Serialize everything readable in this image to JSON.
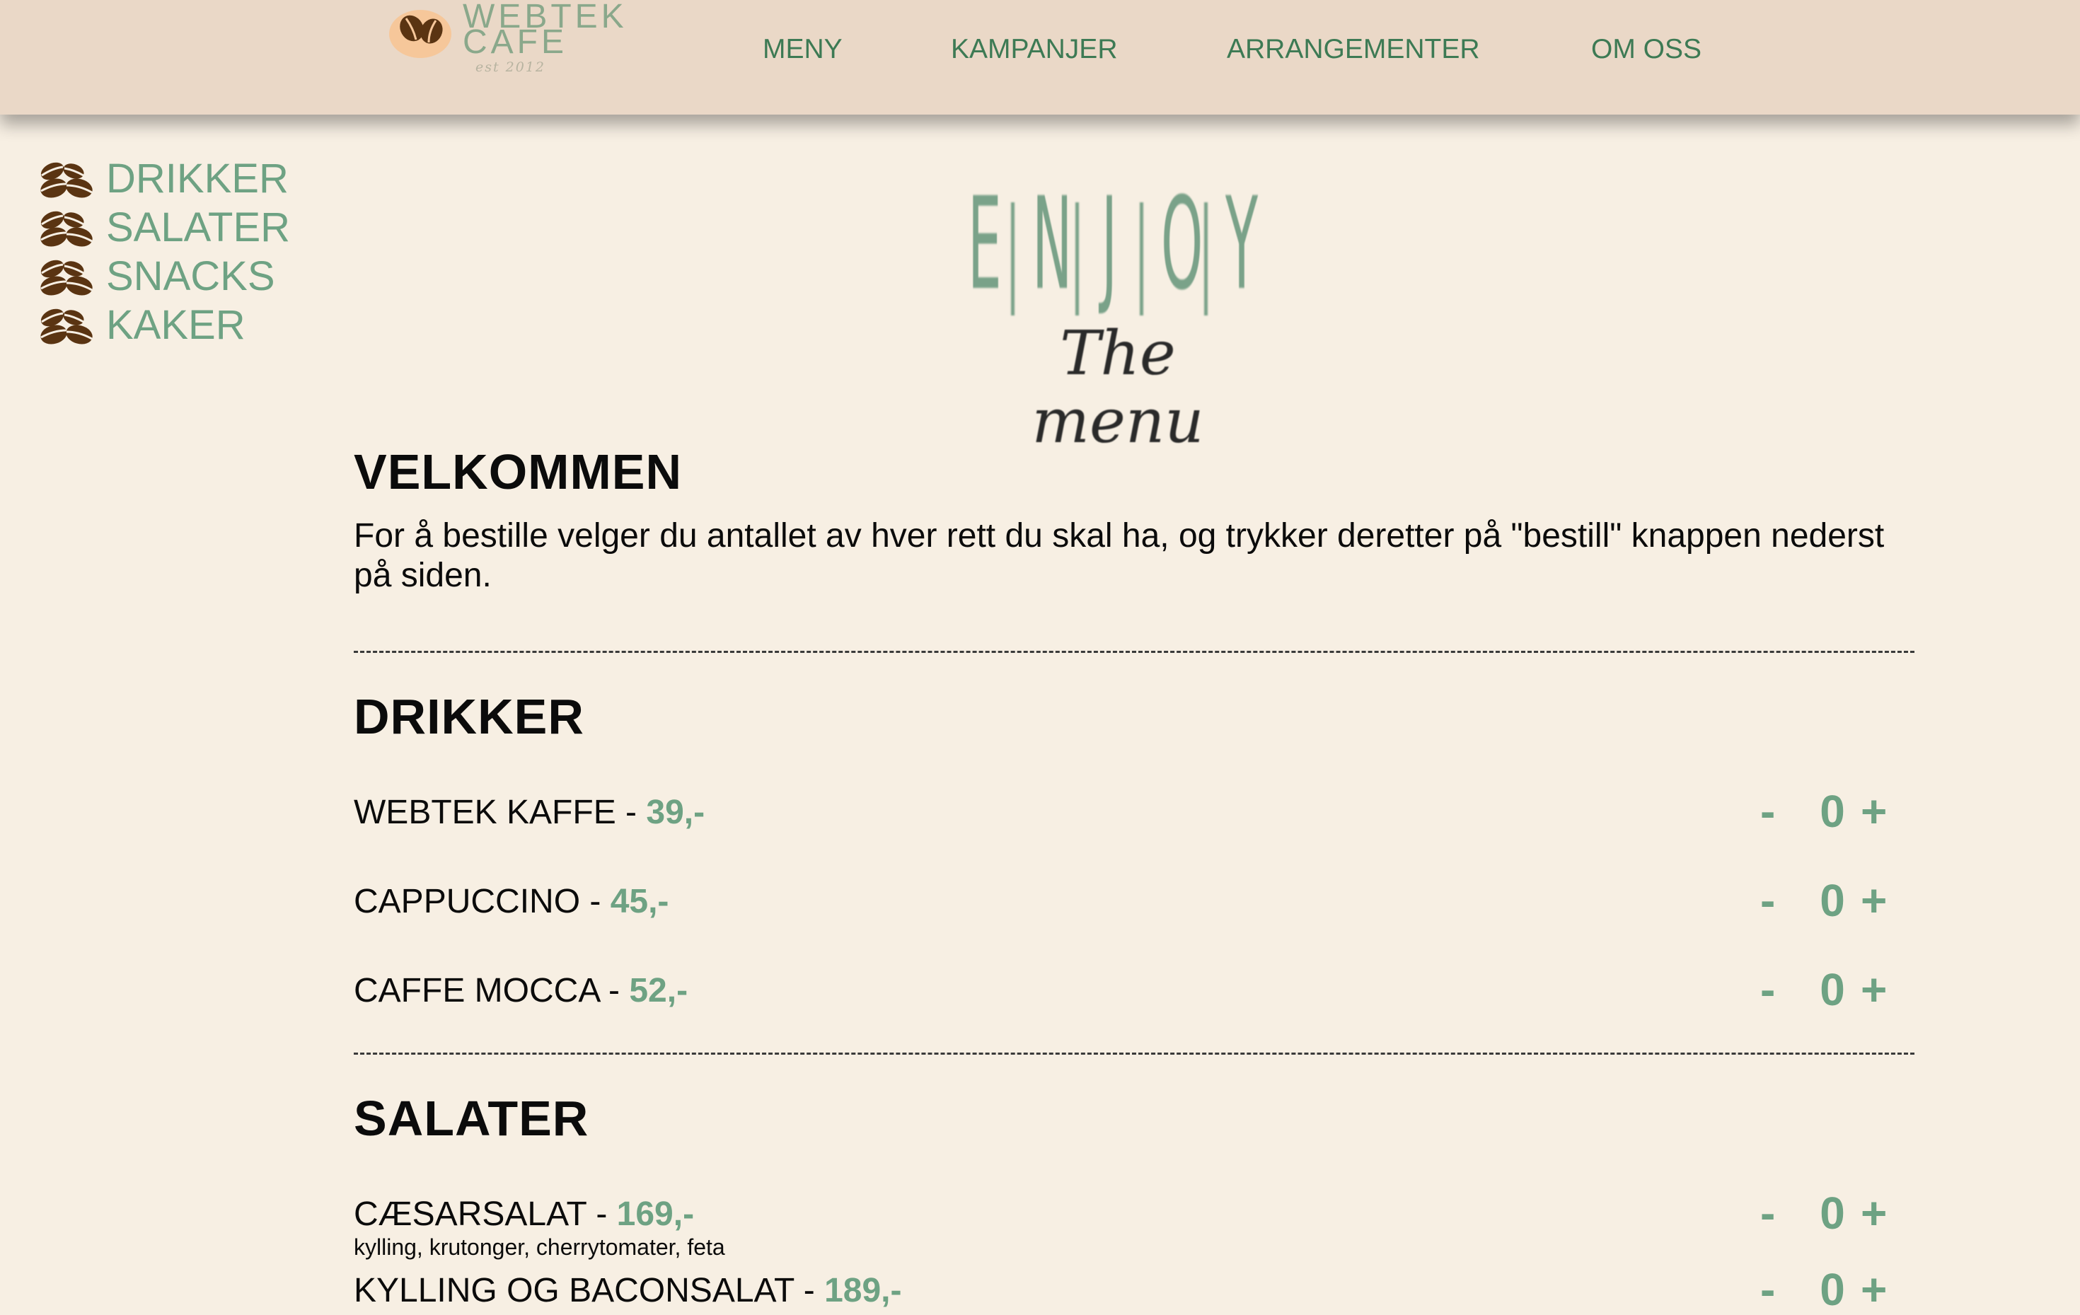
{
  "header": {
    "logo": {
      "line1": "WEBTEK",
      "line2": "CAFE",
      "est": "est 2012"
    },
    "nav": [
      "MENY",
      "KAMPANJER",
      "ARRANGEMENTER",
      "OM OSS"
    ]
  },
  "side_menu": [
    "DRIKKER",
    "SALATER",
    "SNACKS",
    "KAKER"
  ],
  "banner": {
    "letters": [
      "E",
      "N",
      "J",
      "O",
      "Y"
    ],
    "subtitle": "The menu"
  },
  "welcome": {
    "title": "VELKOMMEN",
    "text": "For å bestille velger du antallet av hver rett du skal ha, og trykker deretter på \"bestill\" knappen nederst på siden."
  },
  "sections": [
    {
      "title": "DRIKKER",
      "items": [
        {
          "name": "WEBTEK KAFFE",
          "price": "39,-",
          "qty": "0"
        },
        {
          "name": "CAPPUCCINO",
          "price": "45,-",
          "qty": "0"
        },
        {
          "name": "CAFFE MOCCA",
          "price": "52,-",
          "qty": "0"
        }
      ]
    },
    {
      "title": "SALATER",
      "items": [
        {
          "name": "CÆSARSALAT",
          "price": "169,-",
          "desc": "kylling, krutonger, cherrytomater, feta",
          "qty": "0"
        },
        {
          "name": "KYLLING OG BACONSALAT",
          "price": "189,-",
          "qty": "0"
        }
      ]
    }
  ],
  "controls": {
    "minus": "-",
    "plus": "+",
    "separator": " - "
  },
  "colors": {
    "header_bg": "#ead8c7",
    "page_bg": "#f7efe3",
    "accent": "#6ea283",
    "nav": "#3d7a54",
    "bean": "#5a3412"
  }
}
